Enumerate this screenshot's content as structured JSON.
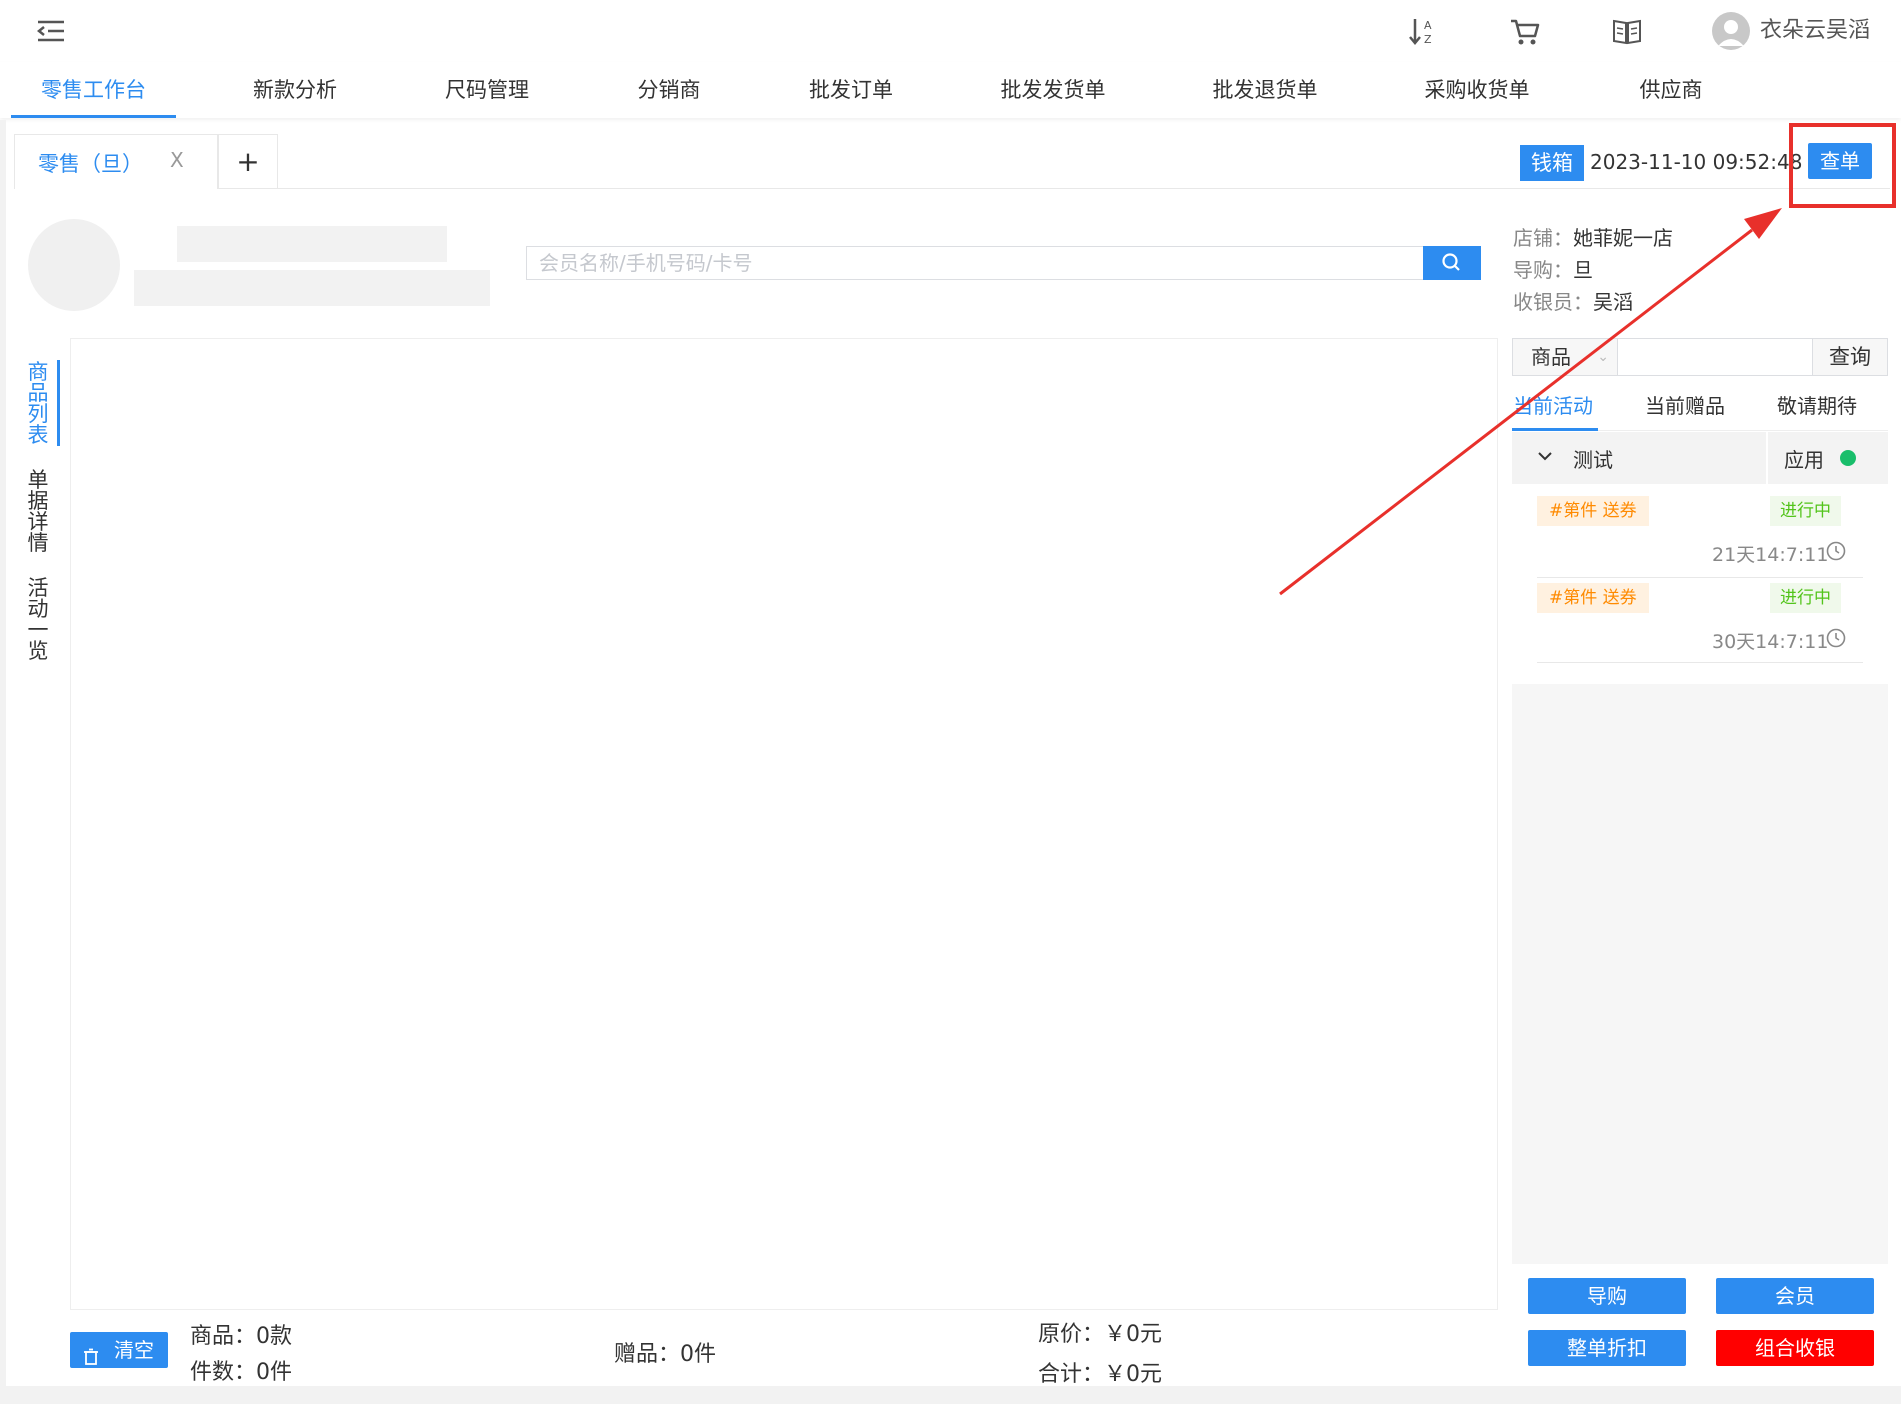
{
  "header": {
    "user_name": "衣朵云吴滔",
    "icons": [
      "menu-fold-icon",
      "sort-az-icon",
      "cart-icon",
      "book-icon",
      "user-avatar-icon"
    ]
  },
  "nav": {
    "items": [
      {
        "label": "零售工作台",
        "active": true
      },
      {
        "label": "新款分析"
      },
      {
        "label": "尺码管理"
      },
      {
        "label": "分销商"
      },
      {
        "label": "批发订单"
      },
      {
        "label": "批发发货单"
      },
      {
        "label": "批发退货单"
      },
      {
        "label": "采购收货单"
      },
      {
        "label": "供应商"
      }
    ]
  },
  "doc_tabs": {
    "active_label": "零售（旦）",
    "close_symbol": "X",
    "add_symbol": "+"
  },
  "toolbar": {
    "cashbox_label": "钱箱",
    "datetime": "2023-11-10 09:52:48",
    "query_order_label": "查单"
  },
  "member": {
    "search_placeholder": "会员名称/手机号码/卡号"
  },
  "side_tabs": [
    {
      "label": "商品列表",
      "active": true
    },
    {
      "label": "单据详情"
    },
    {
      "label": "活动一览"
    }
  ],
  "store_info": {
    "store_label": "店铺：",
    "store_value": "她菲妮一店",
    "guide_label": "导购：",
    "guide_value": "旦",
    "cashier_label": "收银员：",
    "cashier_value": "吴滔"
  },
  "goods_search": {
    "select_value": "商品",
    "query_label": "查询"
  },
  "right_tabs": [
    {
      "label": "当前活动",
      "active": true
    },
    {
      "label": "当前赠品"
    },
    {
      "label": "敬请期待"
    }
  ],
  "promotion": {
    "name": "测试",
    "apply_label": "应用",
    "apply_color": "#19be6b",
    "items": [
      {
        "tag": "#第件 送券",
        "status": "进行中",
        "time": "21天14:7:11"
      },
      {
        "tag": "#第件 送券",
        "status": "进行中",
        "time": "30天14:7:11"
      }
    ]
  },
  "footer": {
    "clear_label": "清空",
    "goods_count": "商品：0款",
    "pieces_count": "件数：0件",
    "gift_count": "赠品：0件",
    "original_price": "原价：￥0元",
    "total": "合计：￥0元"
  },
  "actions": {
    "guide_label": "导购",
    "member_label": "会员",
    "discount_label": "整单折扣",
    "combined_pay_label": "组合收银",
    "primary_color": "#2d8cf0",
    "danger_color": "#ff0000"
  },
  "annotation": {
    "color": "#e8302b"
  }
}
